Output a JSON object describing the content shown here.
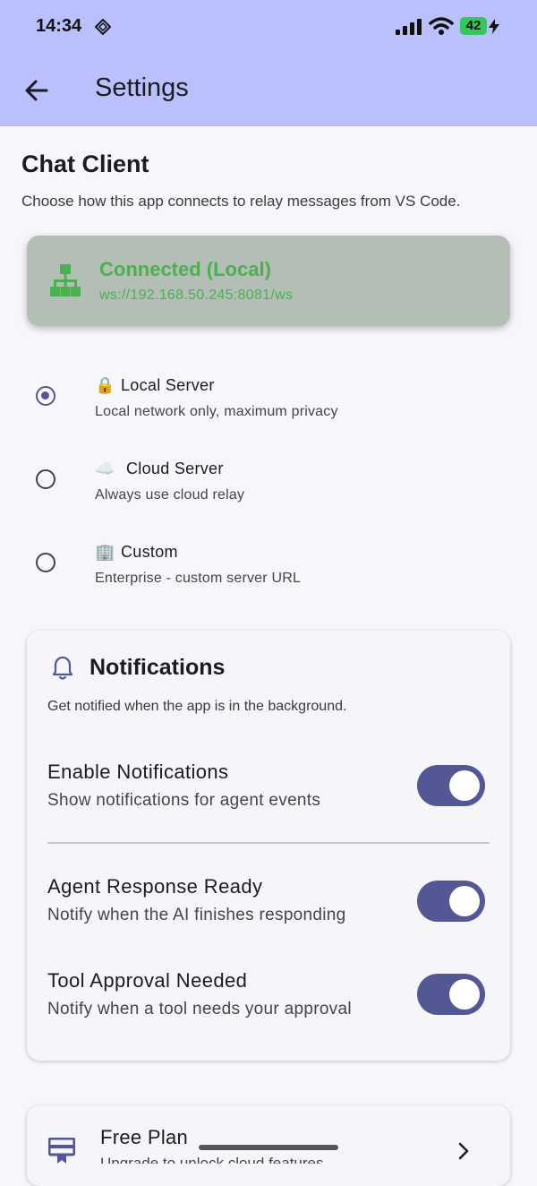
{
  "status_bar": {
    "time": "14:34",
    "battery": "42",
    "icons": [
      "diamond-icon",
      "signal-icon",
      "wifi-icon",
      "battery-icon",
      "charging-bolt-icon"
    ]
  },
  "header": {
    "title": "Settings",
    "back_icon": "arrow-left-icon",
    "background": "#b9c0fd"
  },
  "chat_client": {
    "title": "Chat Client",
    "description": "Choose how this app connects to relay messages from VS Code.",
    "connection": {
      "status": "Connected (Local)",
      "url": "ws://192.168.50.245:8081/ws",
      "icon": "network-icon",
      "status_color": "#4caf50"
    },
    "options": [
      {
        "emoji": "🔒",
        "label": "Local Server",
        "sub": "Local network only, maximum privacy",
        "selected": true
      },
      {
        "emoji": "☁️",
        "label": "Cloud Server",
        "sub": "Always use cloud relay",
        "selected": false
      },
      {
        "emoji": "🏢",
        "label": "Custom",
        "sub": "Enterprise - custom server URL",
        "selected": false
      }
    ]
  },
  "notifications": {
    "title": "Notifications",
    "description": "Get notified when the app is in the background.",
    "icon": "bell-icon",
    "items": [
      {
        "title": "Enable Notifications",
        "sub": "Show notifications for agent events",
        "enabled": true
      },
      {
        "title": "Agent Response Ready",
        "sub": "Notify when the AI finishes responding",
        "enabled": true
      },
      {
        "title": "Tool Approval Needed",
        "sub": "Notify when a tool needs your approval",
        "enabled": true
      }
    ]
  },
  "plan": {
    "title": "Free Plan",
    "sub": "Upgrade to unlock cloud features",
    "icon": "plan-card-icon"
  },
  "colors": {
    "accent": "#535894",
    "connected": "#4caf50",
    "header": "#b9c0fd"
  }
}
